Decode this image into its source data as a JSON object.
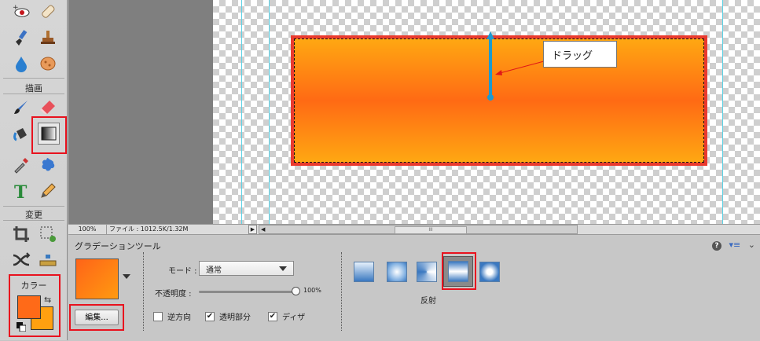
{
  "toolbox": {
    "draw_label": "描画",
    "modify_label": "変更",
    "color_label": "カラー",
    "foreground_color": "#ff6a18",
    "background_color": "#ffa010"
  },
  "canvas": {
    "callout_text": "ドラッグ",
    "gradient_top": "#ffa812",
    "gradient_middle": "#ff6a14",
    "arrow_color": "#1e9ad0"
  },
  "status": {
    "zoom": "100%",
    "file_info": "ファイル : 1012.5K/1.32M",
    "scroll_grip": "III"
  },
  "options": {
    "title": "グラデーションツール",
    "edit_button": "編集...",
    "mode_label": "モード :",
    "mode_value": "通常",
    "opacity_label": "不透明度 :",
    "opacity_value": "100%",
    "reverse_label": "逆方向",
    "reverse_checked": false,
    "transparency_label": "透明部分",
    "transparency_checked": true,
    "dither_label": "ディザ",
    "dither_checked": true,
    "gradient_types": [
      "linear",
      "radial",
      "angle",
      "reflected",
      "diamond"
    ],
    "selected_type_label": "反射",
    "help_icon": "?"
  }
}
